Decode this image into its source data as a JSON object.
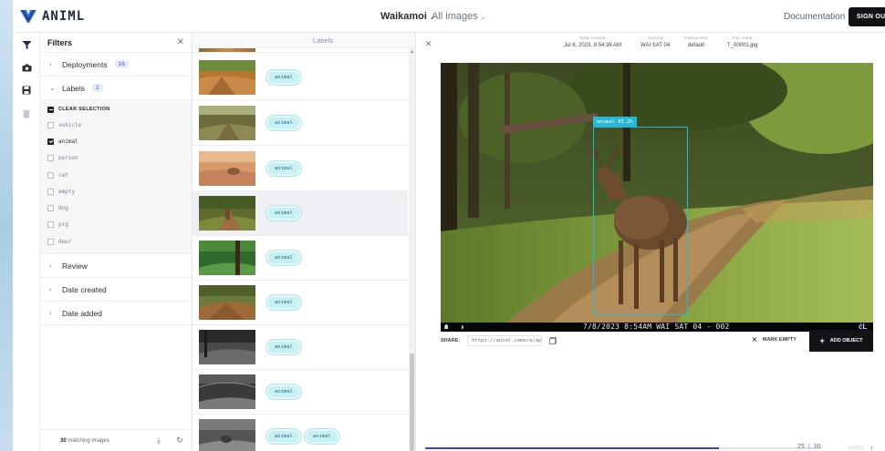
{
  "brand": {
    "name": "ANIML"
  },
  "header": {
    "project": "Waikamoi",
    "view": "All images",
    "documentation": "Documentation",
    "sign_out": "SIGN OUT"
  },
  "rail": {
    "icons": [
      "filter-icon",
      "camera-icon",
      "save-icon",
      "trash-icon"
    ]
  },
  "filters": {
    "title": "Filters",
    "deployments": {
      "label": "Deployments",
      "count": "16"
    },
    "labels": {
      "label": "Labels",
      "count": "1",
      "clear": "CLEAR SELECTION",
      "items": [
        {
          "name": "vehicle",
          "checked": false
        },
        {
          "name": "animal",
          "checked": true
        },
        {
          "name": "person",
          "checked": false
        },
        {
          "name": "cat",
          "checked": false
        },
        {
          "name": "empty",
          "checked": false
        },
        {
          "name": "dog",
          "checked": false
        },
        {
          "name": "pig",
          "checked": false
        },
        {
          "name": "deer",
          "checked": false
        }
      ]
    },
    "review": "Review",
    "date_created": "Date created",
    "date_added": "Date added",
    "footer": {
      "count": "30",
      "text": "matching images"
    }
  },
  "image_list": {
    "header": "Labels",
    "rows": [
      {
        "labels": [
          "animal"
        ]
      },
      {
        "labels": [
          "animal"
        ]
      },
      {
        "labels": [
          "animal"
        ]
      },
      {
        "labels": [
          "animal"
        ],
        "selected": true
      },
      {
        "labels": [
          "animal"
        ]
      },
      {
        "labels": [
          "animal"
        ]
      },
      {
        "labels": [
          "animal"
        ]
      },
      {
        "labels": [
          "animal"
        ]
      },
      {
        "labels": [
          "animal",
          "animal"
        ]
      }
    ]
  },
  "detail": {
    "meta": [
      {
        "key": "Date created",
        "value": "Jul 6, 2023, 8:54:36 AM"
      },
      {
        "key": "Camera",
        "value": "WAI SAT 04"
      },
      {
        "key": "Deployment",
        "value": "default"
      },
      {
        "key": "File name",
        "value": "T_00001.jpg"
      }
    ],
    "detection": {
      "label": "animal 95.2%"
    },
    "stamp": "7/8/2023  8:54AM  WAI SAT 04 - 002",
    "stamp_logo": "ćL",
    "share_label": "SHARE:",
    "share_url": "https://animl.camera/app/",
    "mark_empty": "MARK EMPTY",
    "add_object": "ADD OBJECT",
    "pager": {
      "current": "25",
      "separator": "/",
      "total": "30"
    },
    "progress_fraction": 0.74
  },
  "colors": {
    "accent": "#3444c6",
    "pill_bg": "#c8f0f3",
    "bbox": "#2ab7d6",
    "dark_button": "#111317"
  }
}
